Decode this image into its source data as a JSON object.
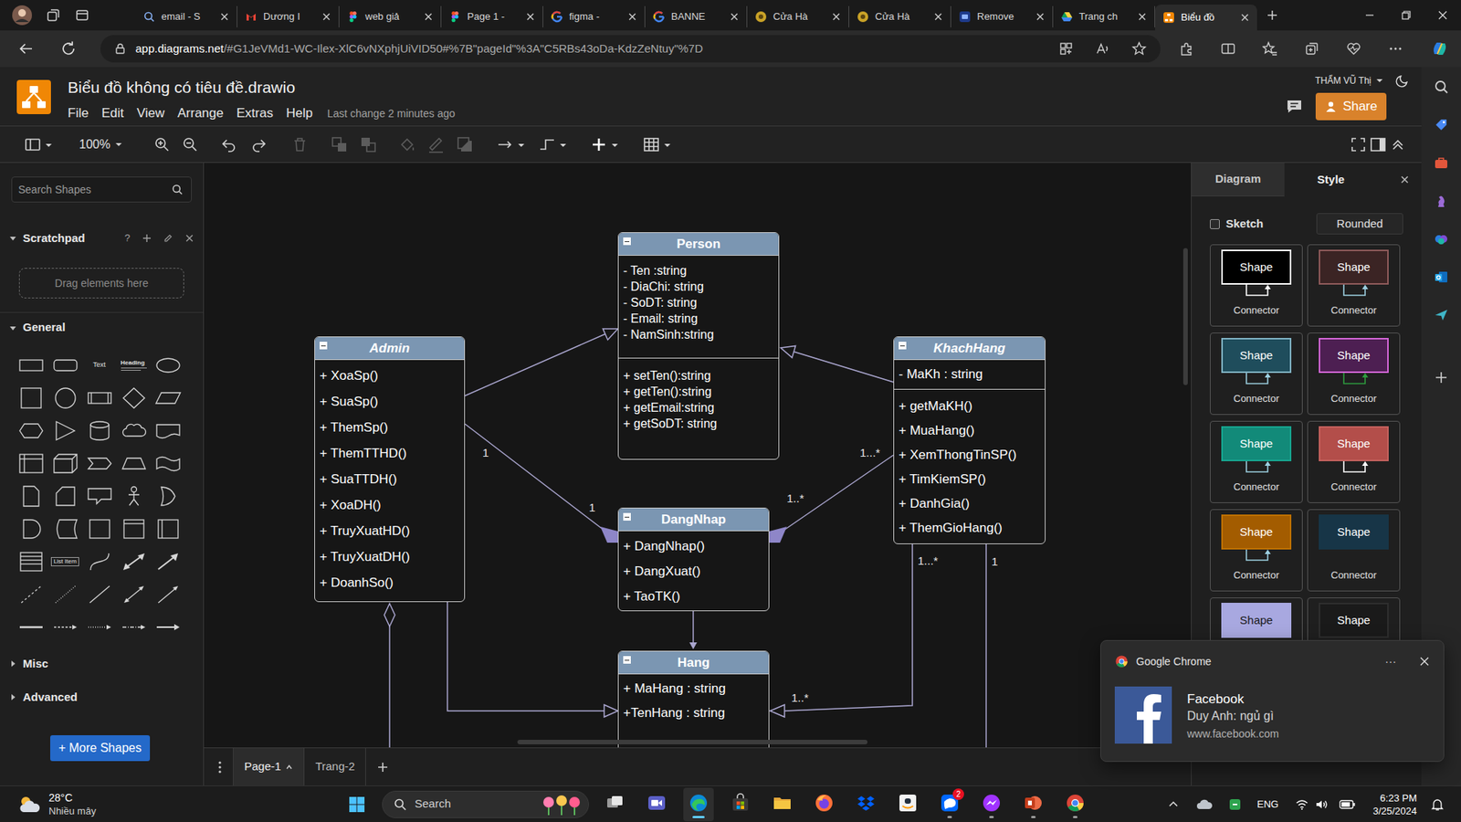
{
  "browser": {
    "tabs": [
      {
        "label": "email - S",
        "kind": "search",
        "selected": false
      },
      {
        "label": "Dương I",
        "kind": "gmail",
        "selected": false
      },
      {
        "label": "web giả",
        "kind": "figma",
        "selected": false
      },
      {
        "label": "Page 1 -",
        "kind": "figma",
        "selected": false
      },
      {
        "label": "figma -",
        "kind": "google",
        "selected": false
      },
      {
        "label": "BANNE",
        "kind": "google",
        "selected": false
      },
      {
        "label": "Cửa Hà",
        "kind": "store",
        "selected": false
      },
      {
        "label": "Cửa Hà",
        "kind": "store",
        "selected": false
      },
      {
        "label": "Remove",
        "kind": "removebg",
        "selected": false
      },
      {
        "label": "Trang ch",
        "kind": "drive",
        "selected": false
      },
      {
        "label": "Biểu đồ",
        "kind": "drawio",
        "selected": true
      }
    ],
    "address": {
      "host": "app.diagrams.net",
      "path": "/#G1JeVMd1-WC-Ilex-XlC6vNXphjUiVID50#%7B\"pageId\"%3A\"C5RBs43oDa-KdzZeNtuy\"%7D"
    }
  },
  "app": {
    "title": "Biểu đồ không có tiêu đề.drawio",
    "menus": [
      "File",
      "Edit",
      "View",
      "Arrange",
      "Extras",
      "Help"
    ],
    "last_change": "Last change 2 minutes ago",
    "user": "THẨM VŨ Thị",
    "share": "Share"
  },
  "toolbar": {
    "zoom": "100%",
    "tools": [
      {
        "kind": "panel",
        "disabled": false
      },
      {
        "kind": "zoom-in",
        "disabled": false
      },
      {
        "kind": "zoom-out",
        "disabled": false
      },
      {
        "kind": "undo",
        "disabled": false
      },
      {
        "kind": "redo",
        "disabled": false
      },
      {
        "kind": "delete",
        "disabled": true
      },
      {
        "kind": "to-front",
        "disabled": true
      },
      {
        "kind": "to-back",
        "disabled": true
      },
      {
        "kind": "fill",
        "disabled": true
      },
      {
        "kind": "line",
        "disabled": true
      },
      {
        "kind": "shadow",
        "disabled": true
      },
      {
        "kind": "connection",
        "disabled": false
      },
      {
        "kind": "waypoints",
        "disabled": false
      },
      {
        "kind": "insert",
        "disabled": false
      },
      {
        "kind": "table",
        "disabled": false
      },
      {
        "kind": "fullscreen",
        "disabled": false
      },
      {
        "kind": "format",
        "disabled": false
      },
      {
        "kind": "collapse",
        "disabled": false
      }
    ]
  },
  "left_panel": {
    "search_placeholder": "Search Shapes",
    "scratchpad": {
      "title": "Scratchpad",
      "help": "?",
      "expanded": true,
      "drop_hint": "Drag elements here"
    },
    "sections": [
      {
        "title": "General",
        "expanded": true
      },
      {
        "title": "Misc",
        "expanded": false
      },
      {
        "title": "Advanced",
        "expanded": false
      }
    ],
    "shape_labels": {
      "text": "Text",
      "heading": "Heading",
      "list_item": "List Item"
    },
    "more_shapes": "+ More Shapes"
  },
  "right_panel": {
    "tabs": [
      {
        "label": "Diagram",
        "selected": false
      },
      {
        "label": "Style",
        "selected": true
      }
    ],
    "sketch": {
      "label": "Sketch",
      "checked": false
    },
    "rounded": "Rounded",
    "styles": [
      {
        "shape": "Shape",
        "connector": "Connector",
        "color": "#000000",
        "stroke": "#ffffff",
        "connector_color": "#ffffff"
      },
      {
        "shape": "Shape",
        "connector": "Connector",
        "color": "#3b2424",
        "stroke": "#8e5a5a",
        "connector_color": "#9ccfe0"
      },
      {
        "shape": "Shape",
        "connector": "Connector",
        "color": "#1f4d5c",
        "stroke": "#80b3c4",
        "connector_color": "#9ccfe0"
      },
      {
        "shape": "Shape",
        "connector": "Connector",
        "color": "#4d1f52",
        "stroke": "#d466d8",
        "connector_color": "#2e9b3e"
      },
      {
        "shape": "Shape",
        "connector": "Connector",
        "color": "#128a79",
        "stroke": "#16a690",
        "connector_color": "#9ccfe0"
      },
      {
        "shape": "Shape",
        "connector": "Connector",
        "color": "#b34e4a",
        "stroke": "#c4615d",
        "connector_color": "#ffffff"
      },
      {
        "shape": "Shape",
        "connector": "Connector",
        "color": "#a35c00",
        "stroke": "#bf7100",
        "connector_color": "#9ccfe0"
      },
      {
        "shape": "Shape",
        "connector": "Connector",
        "color": "#173547",
        "stroke": "#173547",
        "connector_color": null
      },
      {
        "shape": "Shape",
        "connector": null,
        "color": "#a8a8e0",
        "stroke": "#a8a8e0",
        "connector_color": null
      },
      {
        "shape": "Shape",
        "connector": null,
        "color": "#1a1a1a",
        "stroke": "#2e2e2e",
        "connector_color": null
      }
    ]
  },
  "diagram": {
    "classes": [
      {
        "name": "Person",
        "abstract": false,
        "attributes": [
          "- Ten :string",
          "- DiaChi: string",
          "- SoDT: string",
          "- Email: string",
          "- NamSinh:string"
        ],
        "methods": [
          "+ setTen():string",
          "+ getTen():string",
          "+ getEmail:string",
          "+ getSoDT: string"
        ]
      },
      {
        "name": "Admin",
        "abstract": true,
        "attributes": [],
        "methods": [
          "+ XoaSp()",
          "+ SuaSp()",
          "+ ThemSp()",
          "+ ThemTTHD()",
          "+ SuaTTDH()",
          "+ XoaDH()",
          "+ TruyXuatHD()",
          "+ TruyXuatDH()",
          "+ DoanhSo()"
        ]
      },
      {
        "name": "KhachHang",
        "abstract": true,
        "attributes": [
          "- MaKh : string"
        ],
        "methods": [
          "+ getMaKH()",
          "+ MuaHang()",
          "+ XemThongTinSP()",
          "+ TimKiemSP()",
          "+ DanhGia()",
          "+ ThemGioHang()"
        ]
      },
      {
        "name": "DangNhap",
        "abstract": false,
        "attributes": [],
        "methods": [
          "+ DangNhap()",
          "+ DangXuat()",
          "+ TaoTK()"
        ]
      },
      {
        "name": "Hang",
        "abstract": false,
        "attributes": [
          "+ MaHang : string",
          "+TenHang : string"
        ],
        "methods": []
      }
    ],
    "edge_labels": [
      "1",
      "1",
      "1...*",
      "1..*",
      "1...*",
      "1..*",
      "1"
    ]
  },
  "pages": [
    {
      "label": "Page-1",
      "selected": true
    },
    {
      "label": "Trang-2",
      "selected": false
    }
  ],
  "notification": {
    "app": "Google Chrome",
    "more": "···",
    "title": "Facebook",
    "message": "Duy Anh: ngủ gì",
    "source": "www.facebook.com"
  },
  "taskbar": {
    "weather": {
      "temp": "28°C",
      "desc": "Nhiều mây"
    },
    "search": "Search",
    "apps": [
      {
        "kind": "taskview",
        "running": false,
        "active": false
      },
      {
        "kind": "meet",
        "running": false,
        "active": false
      },
      {
        "kind": "edge",
        "running": true,
        "active": true
      },
      {
        "kind": "store",
        "running": false,
        "active": false
      },
      {
        "kind": "explorer",
        "running": false,
        "active": false
      },
      {
        "kind": "firefox",
        "running": false,
        "active": false
      },
      {
        "kind": "dropbox",
        "running": false,
        "active": false
      },
      {
        "kind": "amazon",
        "running": false,
        "active": false
      },
      {
        "kind": "zalo",
        "running": true,
        "active": false,
        "badge": "2"
      },
      {
        "kind": "messenger",
        "running": true,
        "active": false
      },
      {
        "kind": "powerpoint",
        "running": true,
        "active": false
      },
      {
        "kind": "chrome",
        "running": true,
        "active": false
      }
    ],
    "lang": "ENG",
    "time": "6:23 PM",
    "date": "3/25/2024"
  }
}
